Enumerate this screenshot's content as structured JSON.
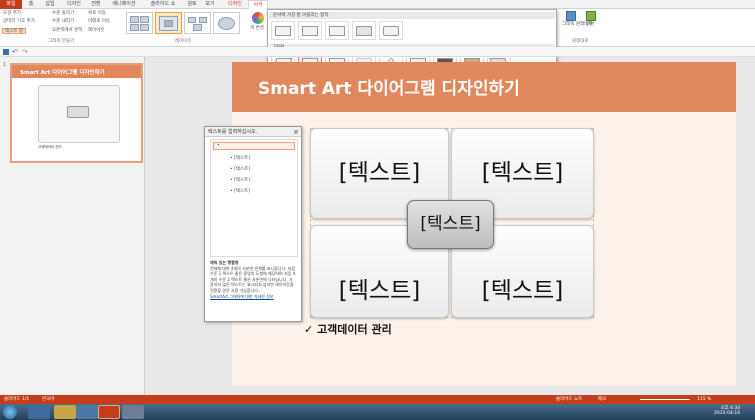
{
  "ribbon": {
    "tabs": [
      "파일",
      "홈",
      "삽입",
      "디자인",
      "전환",
      "애니메이션",
      "슬라이드 쇼",
      "검토",
      "보기",
      "디자인",
      "서식"
    ],
    "create_graphic": {
      "buttons": [
        "도형 추가",
        "글머리 기호 추가",
        "텍스트 창",
        "수준 올리기",
        "수준 내리기",
        "오른쪽에서 왼쪽",
        "위로 이동",
        "아래로 이동",
        "레이아웃"
      ],
      "label": "그래픽 만들기"
    },
    "layouts_label": "레이아웃",
    "color_change_label": "색 변경",
    "reset": {
      "convert_label": "그래픽 원래대로",
      "shape_label": "변환",
      "group_label": "원래대로"
    }
  },
  "gallery": {
    "section1": "문서에 가장 잘 어울리는 항목",
    "section2": "3차원"
  },
  "slide_panel": {
    "number": "1",
    "thumb_title": "Smart Art 다이어그램 디자인하기",
    "thumb_caption": "고객데이터 관리"
  },
  "slide": {
    "title": "Smart Art 다이어그램 디자인하기",
    "boxes": [
      "[텍스트]",
      "[텍스트]",
      "[텍스트]",
      "[텍스트]"
    ],
    "center": "[텍스트]",
    "caption": "고객데이터 관리",
    "check": "✓"
  },
  "text_pane": {
    "title": "텍스트를 입력하십시오.",
    "bullets": [
      "[텍스트]",
      "[텍스트]",
      "[텍스트]",
      "[텍스트]"
    ],
    "desc_title": "채워 있는 행렬형",
    "desc": "전체에 대한 4개의 사분면 관계를 표시합니다. 처음 수준 1 텍스트 줄은 중앙의 도형에 해당하며 처음 4개의 수준 2 텍스트 줄은 사분면에 나타납니다. 사용하지 않은 텍스트는 표시되지 않지만 레이아웃을 전환할 경우 사용 가능합니다.",
    "link": "SmartArt 그래픽에 대한 자세한 정보"
  },
  "status": {
    "slide": "슬라이드 1/1",
    "lang": "한국어",
    "notes": "슬라이드 노트",
    "comments": "메모",
    "zoom": "115 %"
  },
  "taskbar": {
    "time": "오후 4:34",
    "date": "2015-04-16"
  }
}
